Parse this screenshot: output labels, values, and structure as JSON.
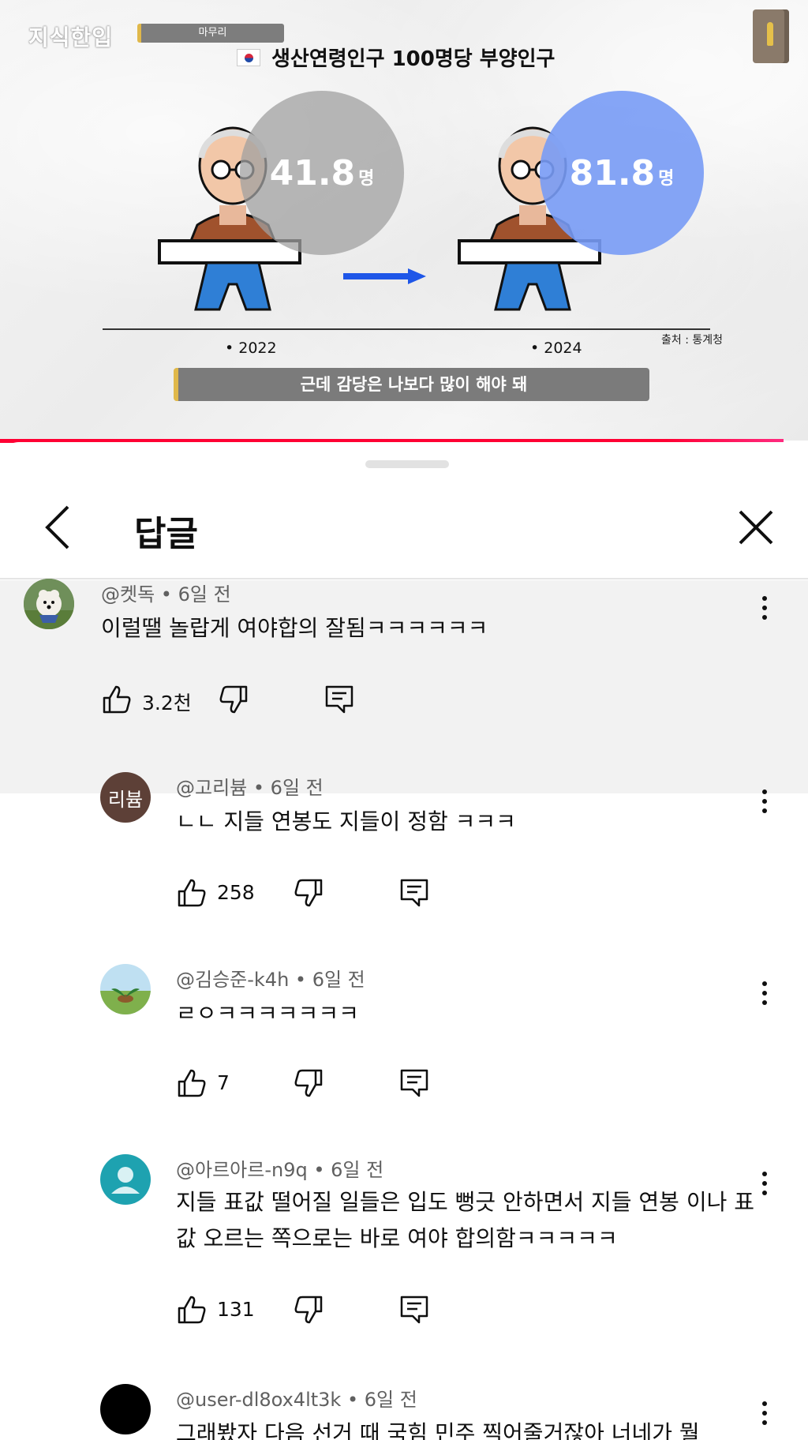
{
  "video": {
    "logo": "지식한입",
    "section_tag": "마무리",
    "title": "생산연령인구 100명당 부양인구",
    "stat_2022": {
      "value": "41.8",
      "unit": "명",
      "year": "• 2022"
    },
    "stat_2024": {
      "value": "81.8",
      "unit": "명",
      "year": "• 2024"
    },
    "source": "출처 : 통계청",
    "caption": "근데 감당은 나보다 많이 해야 돼",
    "progress": 0.97,
    "colors": {
      "progress": "#ff0033",
      "blue_circle": "#789bf5",
      "gray_circle": "#a0a0a0"
    }
  },
  "sheet": {
    "title": "답글",
    "back_icon": "chevron-left-icon",
    "close_icon": "close-icon"
  },
  "comments": [
    {
      "author": "@켓독",
      "time": "6일 전",
      "text": "이럴땔 놀랍게 여야합의 잘됨ㅋㅋㅋㅋㅋㅋ",
      "likes": "3.2천",
      "avatar": "dog-photo"
    },
    {
      "author": "@고리븀",
      "time": "6일 전",
      "text": "ㄴㄴ 지들 연봉도 지들이 정함 ㅋㅋㅋ",
      "likes": "258",
      "avatar_text": "리븀",
      "avatar_color": "#5d4037"
    },
    {
      "author": "@김승준-k4h",
      "time": "6일 전",
      "text": "ㄹㅇㅋㅋㅋㅋㅋㅋㅋ",
      "likes": "7",
      "avatar": "plant-photo"
    },
    {
      "author": "@아르아르-n9q",
      "time": "6일 전",
      "text": "지들 표값 떨어질 일들은 입도 뻥긋 안하면서 지들 연봉 이나 표값 오르는 쪽으로는 바로 여야 합의함ㅋㅋㅋㅋㅋ",
      "likes": "131",
      "avatar": "default-person",
      "avatar_color": "#1ea2b0"
    },
    {
      "author": "@user-dl8ox4lt3k",
      "time": "6일 전",
      "text": "그래봤자 다음 선거 때 국힘 민주 찍어줄거잖아 너네가 뭘",
      "avatar_color": "#000000"
    }
  ]
}
